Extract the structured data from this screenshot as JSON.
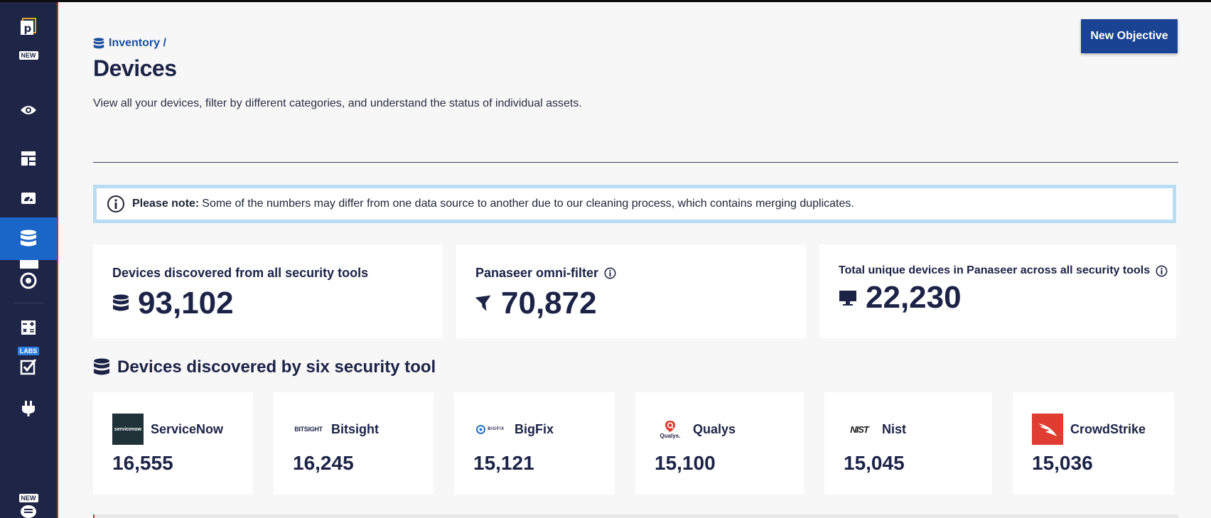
{
  "sidebar": {
    "badge_new_top": "NEW",
    "badge_labs": "LABS",
    "badge_new_bottom": "NEW",
    "items": [
      {
        "name": "eye-icon"
      },
      {
        "name": "dashboard-icon"
      },
      {
        "name": "gauge-icon"
      },
      {
        "name": "database-icon",
        "active": true
      },
      {
        "name": "target-icon"
      },
      {
        "name": "calculator-icon"
      },
      {
        "name": "checkbox-icon"
      },
      {
        "name": "plug-icon"
      },
      {
        "name": "chat-icon"
      }
    ]
  },
  "header": {
    "breadcrumb": "Inventory /",
    "title": "Devices",
    "description": "View all your devices, filter by different categories, and understand the status of individual assets.",
    "new_objective": "New Objective"
  },
  "note": {
    "label": "Please note:",
    "text": "Some of the numbers may differ from one data source to another due to our cleaning process, which contains merging duplicates."
  },
  "stats": [
    {
      "label": "Devices discovered from all security tools",
      "value": "93,102",
      "icon": "database-icon"
    },
    {
      "label": "Panaseer omni-filter",
      "value": "70,872",
      "icon": "filter-icon"
    },
    {
      "label": "Total unique devices in Panaseer across all security tools",
      "value": "22,230",
      "icon": "monitor-icon"
    }
  ],
  "section_title": "Devices discovered by six security tool",
  "tools": [
    {
      "name": "ServiceNow",
      "count": "16,555",
      "logo_text": "servicenow"
    },
    {
      "name": "Bitsight",
      "count": "16,245",
      "logo_text": "BITSIGHT"
    },
    {
      "name": "BigFix",
      "count": "15,121",
      "logo_text": "BIGFIX"
    },
    {
      "name": "Qualys",
      "count": "15,100",
      "logo_text": "Qualys."
    },
    {
      "name": "Nist",
      "count": "15,045",
      "logo_text": "NIST"
    },
    {
      "name": "CrowdStrike",
      "count": "15,036",
      "logo_text": ""
    }
  ],
  "colors": {
    "sidebar": "#1f2547",
    "active": "#1a66c8",
    "primary_button": "#1a4393",
    "text_dark": "#1c2347",
    "note_border": "#b7dcf3",
    "crowdstrike": "#e03c31"
  }
}
